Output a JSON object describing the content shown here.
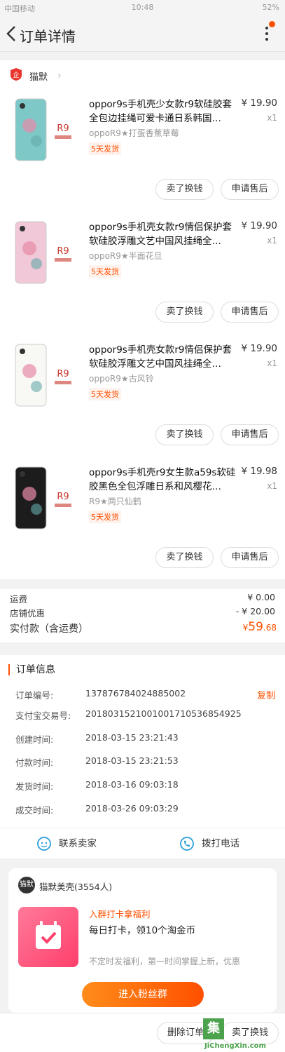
{
  "status_bar": {
    "left": "中国移动",
    "time": "10:48",
    "right": "52%"
  },
  "header": {
    "title": "订单详情"
  },
  "shop": {
    "name": "猫默"
  },
  "items": [
    {
      "title": "oppor9s手机壳少女款r9软硅胶套全包边挂绳可爱卡通日系韩国…",
      "price": "¥ 19.90",
      "qty": "x1",
      "sku": "oppoR9★打蛋香蕉草莓",
      "tag": "5天发货",
      "thumb_model": "R9",
      "thumb_color": "#7ec8c8"
    },
    {
      "title": "oppor9s手机壳女款r9情侣保护套软硅胶浮雕文艺中国风挂绳全…",
      "price": "¥ 19.90",
      "qty": "x1",
      "sku": "oppoR9★半面花旦",
      "tag": "5天发货",
      "thumb_model": "R9",
      "thumb_color": "#f0c8d8"
    },
    {
      "title": "oppor9s手机壳女款r9情侣保护套软硅胶浮雕文艺中国风挂绳全…",
      "price": "¥ 19.90",
      "qty": "x1",
      "sku": "oppoR9★古风铃",
      "tag": "5天发货",
      "thumb_model": "R9",
      "thumb_color": "#f8f8f4"
    },
    {
      "title": "oppor9s手机壳r9女生款a59s软硅胶黑色全包浮雕日系和风樱花…",
      "price": "¥ 19.98",
      "qty": "x1",
      "sku": "R9★两只仙鹤",
      "tag": "5天发货",
      "thumb_model": "R9",
      "thumb_color": "#1c1c1c"
    }
  ],
  "item_buttons": {
    "sell": "卖了换钱",
    "service": "申请售后"
  },
  "summary": {
    "shipping_label": "运费",
    "shipping_value": "¥ 0.00",
    "discount_label": "店铺优惠",
    "discount_value": "- ¥ 20.00",
    "total_label": "实付款（含运费）",
    "total_symbol": "¥",
    "total_int": "59",
    "total_dec": ".68"
  },
  "order_info": {
    "heading": "订单信息",
    "copy": "复制",
    "rows": [
      {
        "key": "订单编号:",
        "value": "137876784024885002"
      },
      {
        "key": "支付宝交易号:",
        "value": "2018031521001001710536854925"
      },
      {
        "key": "创建时间:",
        "value": "2018-03-15 23:21:43"
      },
      {
        "key": "付款时间:",
        "value": "2018-03-15 23:21:53"
      },
      {
        "key": "发货时间:",
        "value": "2018-03-16 09:03:18"
      },
      {
        "key": "成交时间:",
        "value": "2018-03-26 09:03:29"
      }
    ],
    "contact_seller": "联系卖家",
    "call_phone": "拨打电话"
  },
  "fan_card": {
    "avatar": "猫默",
    "name": "猫默美壳(3554人)",
    "title": "入群打卡拿福利",
    "subtitle": "每日打卡，领10个淘金币",
    "desc": "不定时发福利，第一时间掌握上新，优惠",
    "button": "进入粉丝群"
  },
  "bottom_bar": {
    "delete": "删除订单",
    "sell": "卖了换钱"
  },
  "watermark": {
    "mark": "集",
    "url": "JiChengXin.com"
  },
  "colors": {
    "accent": "#ff5000",
    "background": "#f2f2f2"
  }
}
